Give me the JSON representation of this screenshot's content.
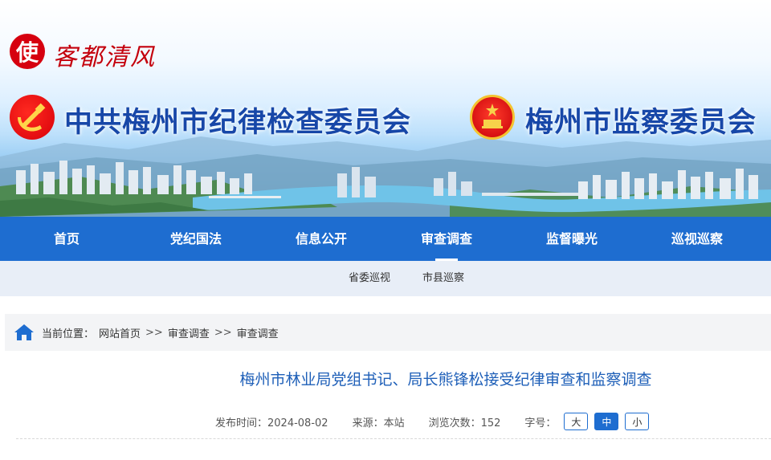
{
  "site": {
    "logo_char": "使",
    "logo_text": "客都清风",
    "title_left": "中共梅州市纪律检查委员会",
    "title_right": "梅州市监察委员会"
  },
  "nav": {
    "items": [
      {
        "label": "首页"
      },
      {
        "label": "党纪国法"
      },
      {
        "label": "信息公开"
      },
      {
        "label": "审查调查"
      },
      {
        "label": "监督曝光"
      },
      {
        "label": "巡视巡察"
      }
    ],
    "active": "审查调查"
  },
  "subnav": {
    "items": [
      {
        "label": "省委巡视"
      },
      {
        "label": "市县巡察"
      }
    ]
  },
  "breadcrumb": {
    "prefix": "当前位置：",
    "items": [
      "网站首页",
      "审查调查",
      "审查调查"
    ],
    "separator": ">>"
  },
  "article": {
    "title": "梅州市林业局党组书记、局长熊锋松接受纪律审查和监察调查",
    "published": "发布时间：2024-08-02",
    "source": "来源：本站",
    "views": "浏览次数：152",
    "font_size_label": "字号：",
    "sizes": [
      "大",
      "中",
      "小"
    ],
    "active_size": "中"
  },
  "colors": {
    "nav_blue": "#1e6dd0",
    "title_blue": "#1747a8",
    "brand_red": "#d6000f"
  }
}
